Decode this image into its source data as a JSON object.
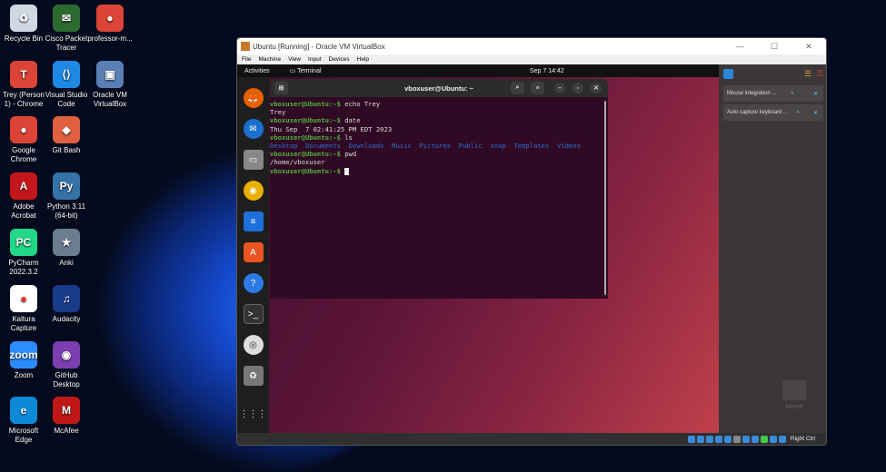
{
  "desktop": {
    "icons": [
      {
        "label": "Recycle Bin",
        "color": "#cfd8e3",
        "glyph": "♻"
      },
      {
        "label": "Cisco Packet Tracer",
        "color": "#2c6b2f",
        "glyph": "✉"
      },
      {
        "label": "professor-m...",
        "color": "#db4437",
        "glyph": "●"
      },
      {
        "label": "Trey (Person 1) - Chrome",
        "color": "#db4437",
        "glyph": "T"
      },
      {
        "label": "Visual Studio Code",
        "color": "#1e88e5",
        "glyph": "⟨⟩"
      },
      {
        "label": "Oracle VM VirtualBox",
        "color": "#5a7fb5",
        "glyph": "▣"
      },
      {
        "label": "Google Chrome",
        "color": "#db4437",
        "glyph": "●"
      },
      {
        "label": "Git Bash",
        "color": "#e06040",
        "glyph": "◆"
      },
      {
        "label": "Adobe Acrobat",
        "color": "#c4161c",
        "glyph": "A"
      },
      {
        "label": "Python 3.11 (64-bit)",
        "color": "#3572a5",
        "glyph": "Py"
      },
      {
        "label": "PyCharm 2022.3.2",
        "color": "#21d789",
        "glyph": "PC"
      },
      {
        "label": "Anki",
        "color": "#6b7d8f",
        "glyph": "★"
      },
      {
        "label": "Kaltura Capture",
        "color": "#ffffff",
        "glyph": "●"
      },
      {
        "label": "Audacity",
        "color": "#1a3a8a",
        "glyph": "♫"
      },
      {
        "label": "Zoom",
        "color": "#2d8cff",
        "glyph": "zoom"
      },
      {
        "label": "GitHub Desktop",
        "color": "#7b3fb0",
        "glyph": "◉"
      },
      {
        "label": "Microsoft Edge",
        "color": "#0c8ad8",
        "glyph": "e"
      },
      {
        "label": "McAfee",
        "color": "#c01818",
        "glyph": "M"
      }
    ]
  },
  "vbox": {
    "title": "Ubuntu [Running] - Oracle VM VirtualBox",
    "menu": [
      "File",
      "Machine",
      "View",
      "Input",
      "Devices",
      "Help"
    ],
    "status_key": "Right Ctrl",
    "notifications": [
      "Mouse integration ...",
      "Auto capture keyboard ..."
    ]
  },
  "ubuntu": {
    "activities": "Activities",
    "app": "Terminal",
    "clock": "Sep 7  14:42",
    "home_label": "Home"
  },
  "terminal": {
    "title": "vboxuser@Ubuntu: ~",
    "prompt": "vboxuser@Ubuntu:~$ ",
    "cmd1": "echo Trey",
    "out1": "Trey",
    "cmd2": "date",
    "out2": "Thu Sep  7 02:41:25 PM EDT 2023",
    "cmd3": "ls",
    "ls": [
      "Desktop",
      "Documents",
      "Downloads",
      "Music",
      "Pictures",
      "Public",
      "snap",
      "Templates",
      "Videos"
    ],
    "cmd4": "pwd",
    "out4": "/home/vboxuser"
  }
}
